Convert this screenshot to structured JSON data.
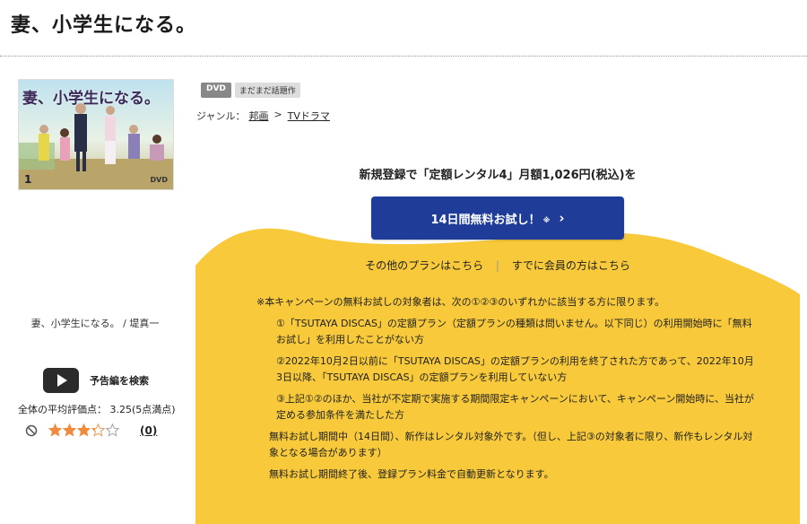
{
  "page_title": "妻、小学生になる。",
  "poster": {
    "title": "妻、小学生になる。",
    "volume": "1",
    "format_mark": "DVD"
  },
  "side": {
    "caption": "妻、小学生になる。 / 堤真一",
    "trailer_label": "予告編を検索",
    "rating_text": "全体の平均評価点： 3.25(5点満点)",
    "rating_value": 3.25,
    "rating_max": 5,
    "rating_count": "(0)",
    "icons": {
      "no_rating": "no-entry-icon",
      "trailer": "play-icon",
      "star": "star-icon"
    }
  },
  "badges": {
    "format": "DVD",
    "topic": "まだまだ話題作"
  },
  "genre": {
    "label": "ジャンル：",
    "items": [
      "邦画",
      "TVドラマ"
    ],
    "separator": ">"
  },
  "campaign": {
    "headline": "新規登録で「定額レンタル4」月額1,026円(税込)を",
    "cta_label": "14日間無料お試し！",
    "cta_note": "※",
    "cta_chevron": "chevron-right-icon",
    "other_plans": "その他のプランはこちら",
    "member_link": "すでに会員の方はこちら",
    "separator": "|"
  },
  "terms": {
    "lead": "※本キャンペーンの無料お試しの対象者は、次の①②③のいずれかに該当する方に限ります。",
    "items": [
      "①「TSUTAYA DISCAS」の定額プラン（定額プランの種類は問いません。以下同じ）の利用開始時に「無料お試し」を利用したことがない方",
      "②2022年10月2日以前に「TSUTAYA DISCAS」の定額プランの利用を終了された方であって、2022年10月3日以降、「TSUTAYA DISCAS」の定額プランを利用していない方",
      "③上記①②のほか、当社が不定期で実施する期間限定キャンペーンにおいて、キャンペーン開始時に、当社が定める参加条件を満たした方"
    ],
    "notes": [
      "無料お試し期間中（14日間）、新作はレンタル対象外です。（但し、上記③の対象者に限り、新作もレンタル対象となる場合があります）",
      "無料お試し期間終了後、登録プラン料金で自動更新となります。"
    ]
  },
  "colors": {
    "accent_yellow": "#f7c93b",
    "cta_blue": "#1f3d98",
    "star_orange": "#f08a3c"
  }
}
